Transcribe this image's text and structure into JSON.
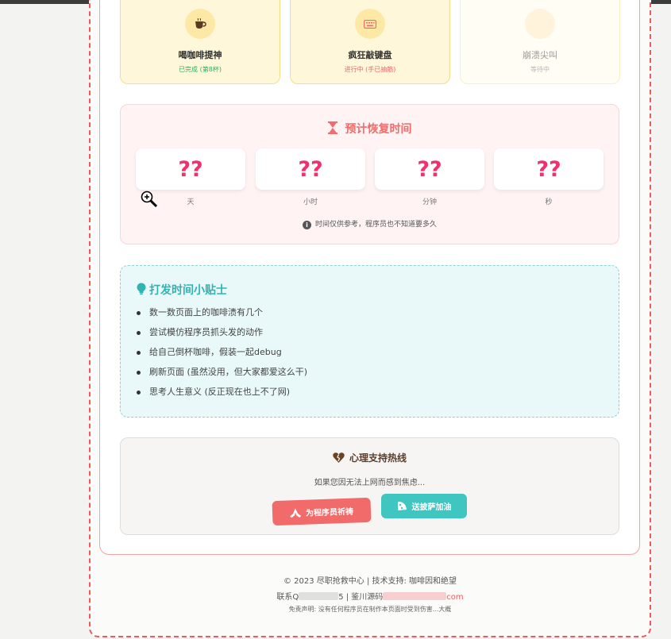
{
  "statuses": [
    {
      "title": "喝咖啡提神",
      "sub": "已完成 (第8杯)",
      "sub_color": "#2fae63",
      "icon": "coffee-icon"
    },
    {
      "title": "疯狂敲键盘",
      "sub": "进行中 (手已抽筋)",
      "sub_color": "#f06a6a",
      "icon": "keyboard-icon"
    },
    {
      "title": "崩溃尖叫",
      "sub": "等待中",
      "sub_color": "#b5b5b5",
      "icon": "scream-icon"
    }
  ],
  "recovery": {
    "title": "预计恢复时间",
    "units": [
      {
        "value": "??",
        "label": "天"
      },
      {
        "value": "??",
        "label": "小时"
      },
      {
        "value": "??",
        "label": "分钟"
      },
      {
        "value": "??",
        "label": "秒"
      }
    ],
    "note": "时间仅供参考，程序员也不知道要多久"
  },
  "tips": {
    "title": "打发时间小贴士",
    "items": [
      "数一数页面上的咖啡渍有几个",
      "尝试模仿程序员抓头发的动作",
      "给自己倒杯咖啡，假装一起debug",
      "刷新页面 (虽然没用，但大家都爱这么干)",
      "思考人生意义 (反正现在也上不了网)"
    ]
  },
  "support": {
    "title": "心理支持热线",
    "subtitle": "如果您因无法上网而感到焦虑...",
    "pray_label": "为程序员祈祷",
    "pizza_label": "送披萨加油"
  },
  "footer": {
    "line1_a": "© 2023",
    "line1_b": "尽职抢救中心 | 技术支持: 咖啡因和绝望",
    "line2_a": "联系Q",
    "line2_b": "5 | 鉴川源码",
    "line2_c": "com",
    "line3": "免责声明: 没有任何程序员在制作本页面时受到伤害...大概"
  },
  "colors": {
    "accent": "#ee5a5a",
    "teal": "#30b3b3",
    "pink_number": "#f2306e"
  }
}
